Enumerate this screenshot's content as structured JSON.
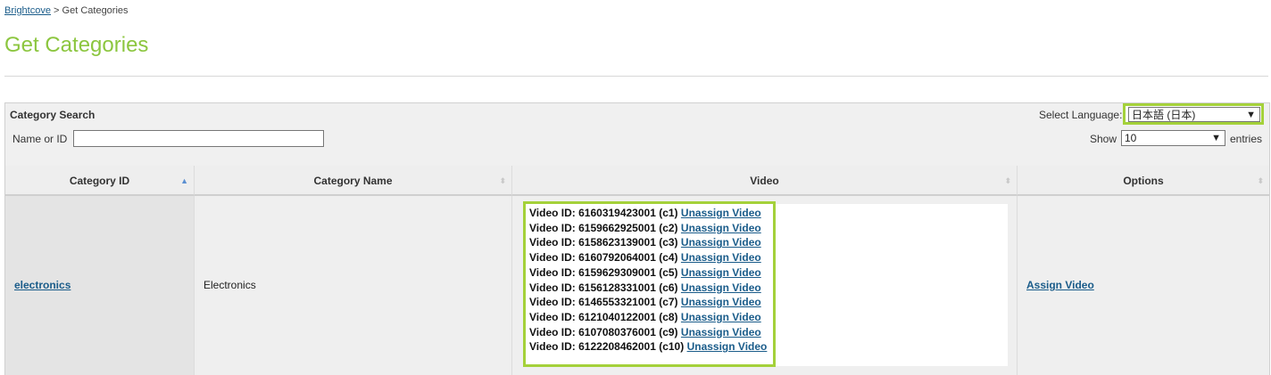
{
  "breadcrumb": {
    "link": "Brightcove",
    "separator": ">",
    "current": "Get Categories"
  },
  "page_title": "Get Categories",
  "search": {
    "title": "Category Search",
    "name_label": "Name or ID",
    "name_value": "",
    "language_label": "Select Language:",
    "language_value": "日本語 (日本)",
    "show_label": "Show",
    "show_value": "10",
    "entries_label": "entries"
  },
  "table": {
    "columns": [
      "Category ID",
      "Category Name",
      "Video",
      "Options"
    ],
    "sort_column": "Category ID",
    "rows": [
      {
        "category_id": "electronics",
        "category_name": "Electronics",
        "option": "Assign Video",
        "videos": [
          {
            "prefix": "Video ID: 6160319423001 (c1)",
            "link": "Unassign Video"
          },
          {
            "prefix": "Video ID: 6159662925001 (c2)",
            "link": "Unassign Video"
          },
          {
            "prefix": "Video ID: 6158623139001 (c3)",
            "link": "Unassign Video"
          },
          {
            "prefix": "Video ID: 6160792064001 (c4)",
            "link": "Unassign Video"
          },
          {
            "prefix": "Video ID: 6159629309001 (c5)",
            "link": "Unassign Video"
          },
          {
            "prefix": "Video ID: 6156128331001 (c6)",
            "link": "Unassign Video"
          },
          {
            "prefix": "Video ID: 6146553321001 (c7)",
            "link": "Unassign Video"
          },
          {
            "prefix": "Video ID: 6121040122001 (c8)",
            "link": "Unassign Video"
          },
          {
            "prefix": "Video ID: 6107080376001 (c9)",
            "link": "Unassign Video"
          },
          {
            "prefix": "Video ID: 6122208462001 (c10)",
            "link": "Unassign Video"
          }
        ]
      }
    ]
  },
  "colors": {
    "accent": "#8cc63f",
    "highlight": "#a4d13a",
    "link": "#1a5c8a",
    "sort_active": "#5b8fd1"
  },
  "icons": {
    "sort_asc": "sort-ascending-icon",
    "sort_both": "sort-both-icon",
    "dropdown": "chevron-down-icon"
  }
}
